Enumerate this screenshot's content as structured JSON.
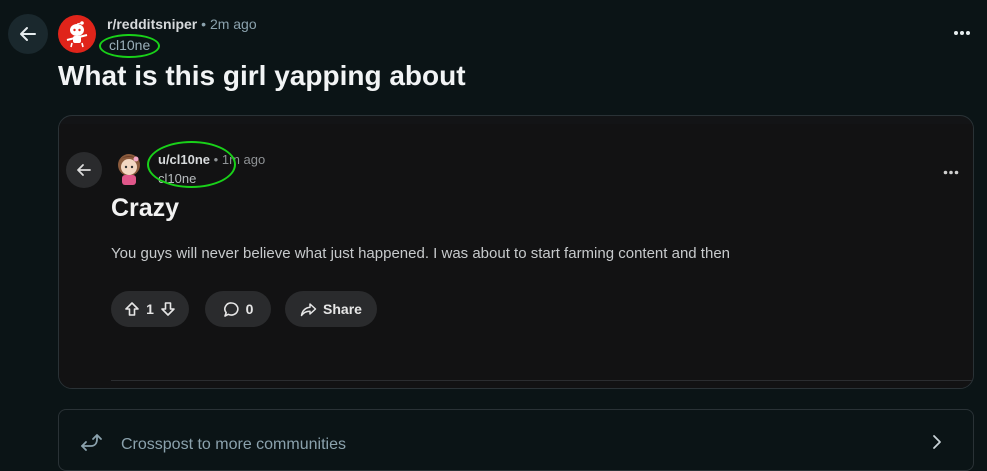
{
  "post": {
    "subreddit": "r/redditsniper",
    "separator": "•",
    "time": "2m ago",
    "author": "cl10ne",
    "title": "What is this girl yapping about"
  },
  "embedded": {
    "user": "u/cl10ne",
    "separator": "•",
    "time": "1m ago",
    "author": "cl10ne",
    "title": "Crazy",
    "body": "You guys will never believe what just happened. I was about to start farming content and then",
    "votes": "1",
    "comments": "0",
    "share_label": "Share"
  },
  "crosspost": {
    "label": "Crosspost to more communities"
  },
  "colors": {
    "background": "#0b1416",
    "highlight_circle": "#19d119",
    "subreddit_avatar": "#e0241a"
  },
  "icons": {
    "back": "arrow-left-icon",
    "more": "more-options-icon",
    "upvote": "upvote-icon",
    "downvote": "downvote-icon",
    "comment": "comment-icon",
    "share": "share-icon",
    "crosspost": "crosspost-icon",
    "chevron": "chevron-right-icon"
  }
}
